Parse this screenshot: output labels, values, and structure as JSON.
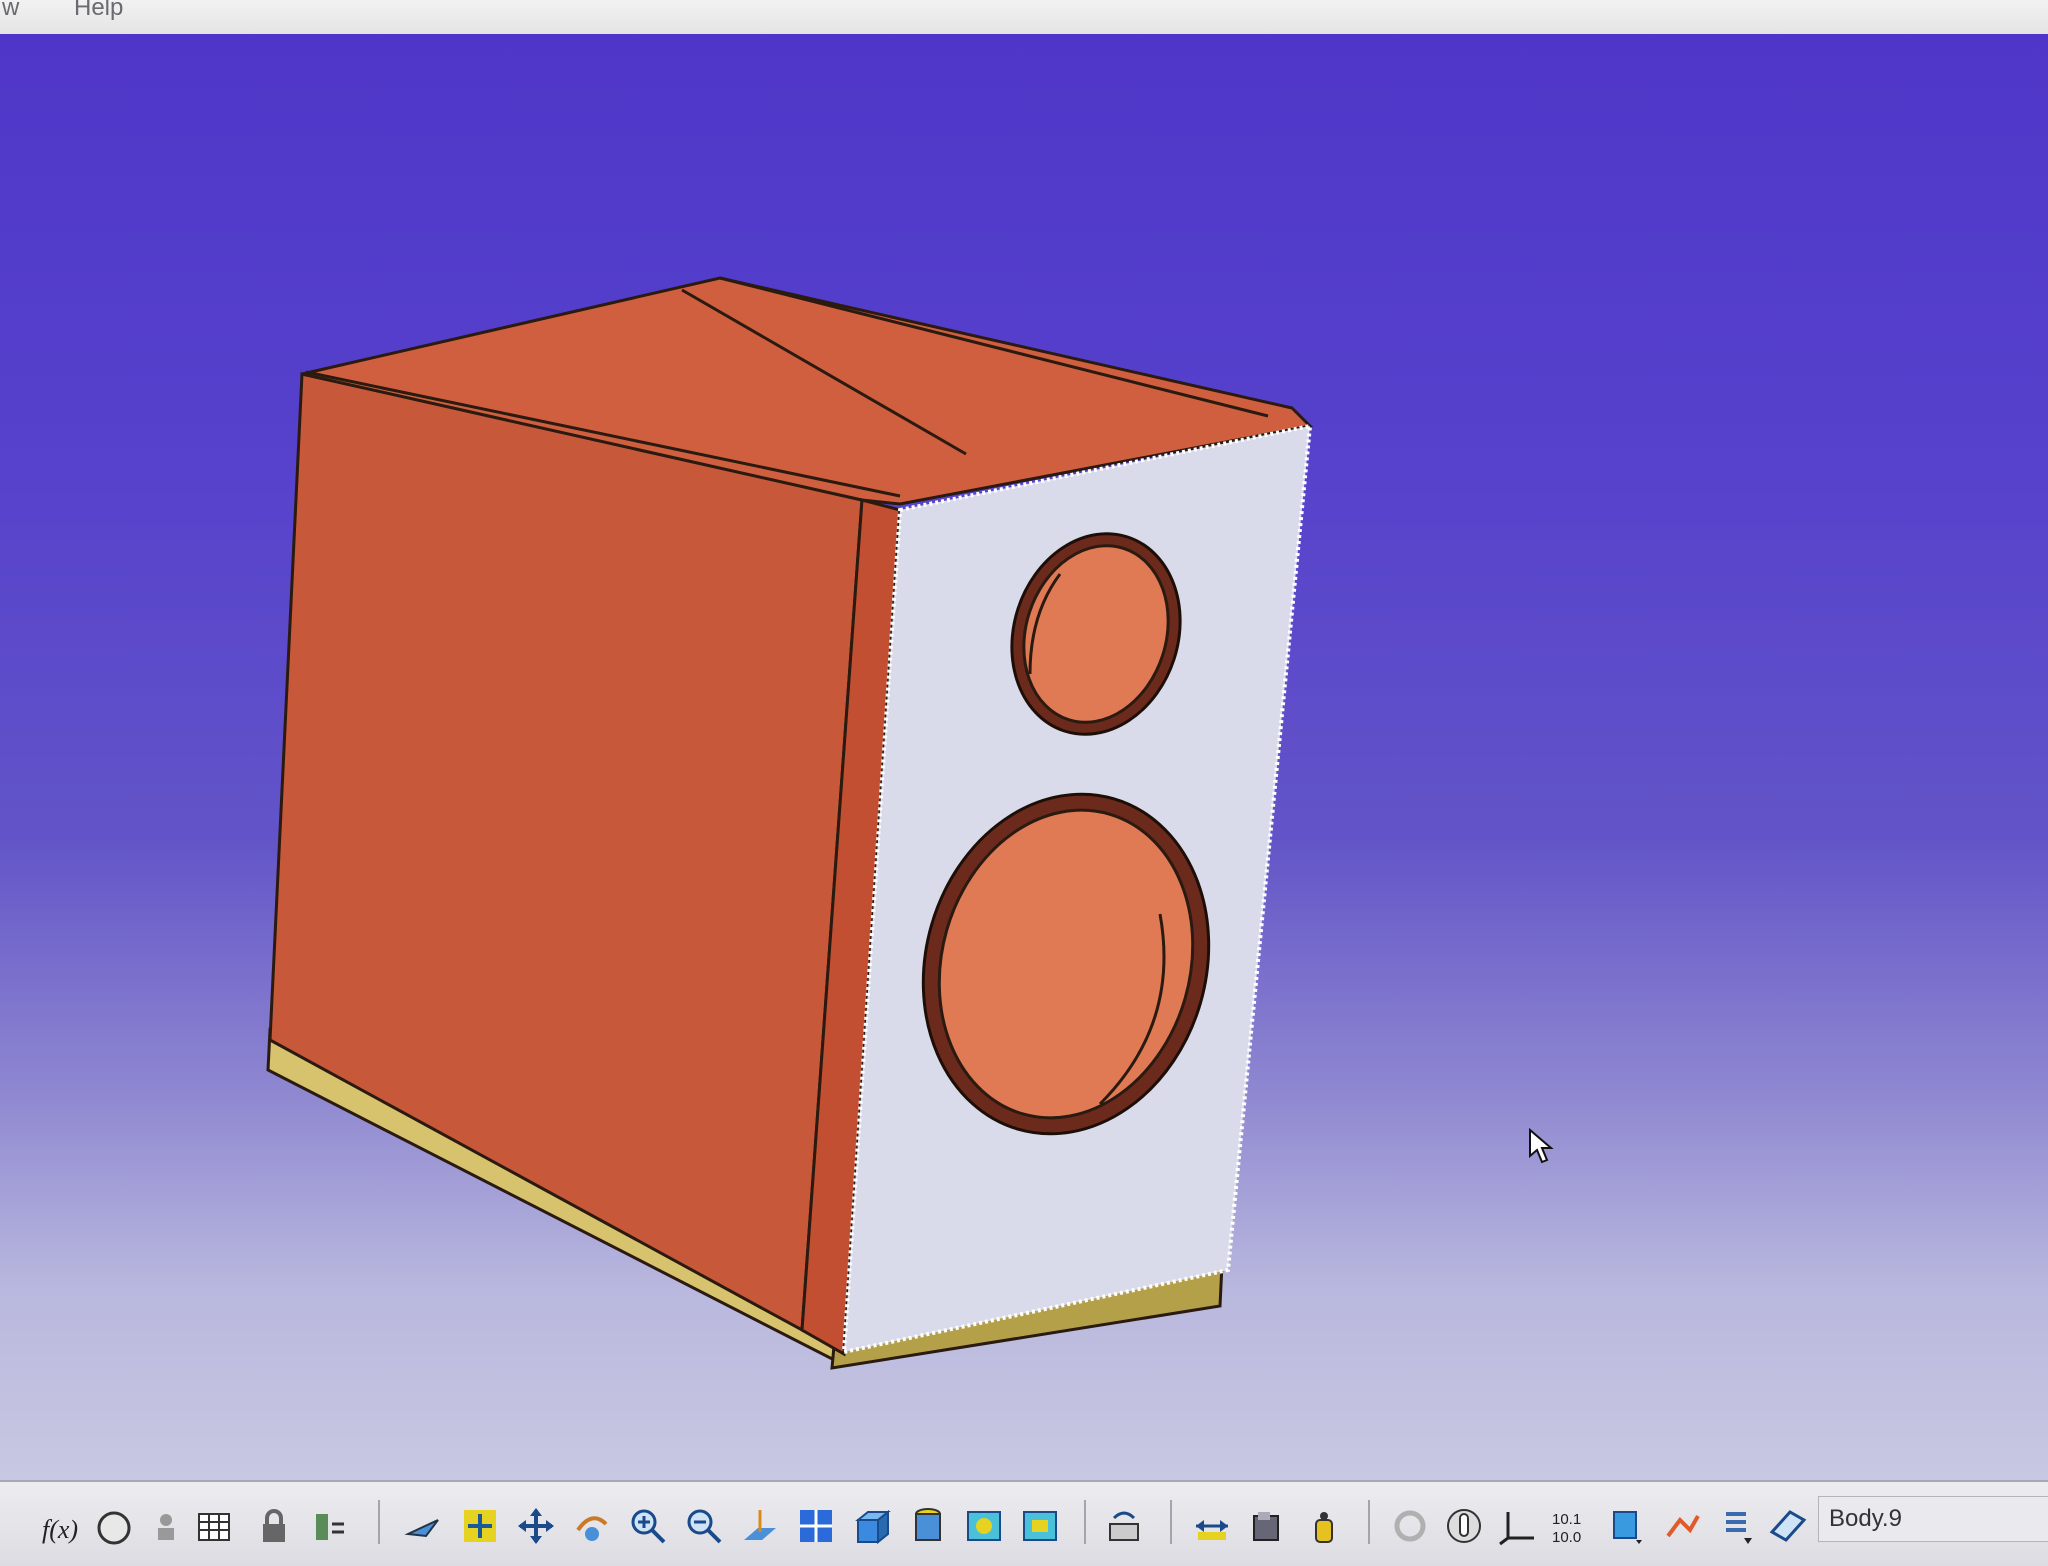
{
  "menubar": {
    "items": [
      {
        "label": "w"
      },
      {
        "label": "Help"
      }
    ]
  },
  "viewport": {
    "model": "speaker-enclosure",
    "colors": {
      "background_top": "#4f36c9",
      "background_bottom": "#c9c9e2",
      "cabinet_side": "#c8583a",
      "cabinet_top": "#cf5f3f",
      "front_baffle": "#d9dbea",
      "base_plinth": "#d7c36e",
      "driver_cutout": "#e07a55"
    }
  },
  "toolbar": {
    "icons": [
      "formula-icon",
      "knowledge-icon",
      "user-icon",
      "table-icon",
      "lock-icon",
      "parameter-icon",
      "fly-mode-icon",
      "fit-all-icon",
      "pan-icon",
      "rotate-icon",
      "zoom-in-icon",
      "zoom-out-icon",
      "normal-view-icon",
      "multi-view-icon",
      "isometric-view-icon",
      "shading-icon",
      "hide-show-icon",
      "swap-visible-icon",
      "section-icon",
      "measure-between-icon",
      "measure-item-icon",
      "measure-inertia-icon",
      "update-icon",
      "manipulate-icon",
      "axis-system-icon",
      "dimension-icon",
      "plane-icon",
      "sketch-icon",
      "list-icon",
      "select-body-icon"
    ],
    "current_body_label": "Body.9"
  }
}
